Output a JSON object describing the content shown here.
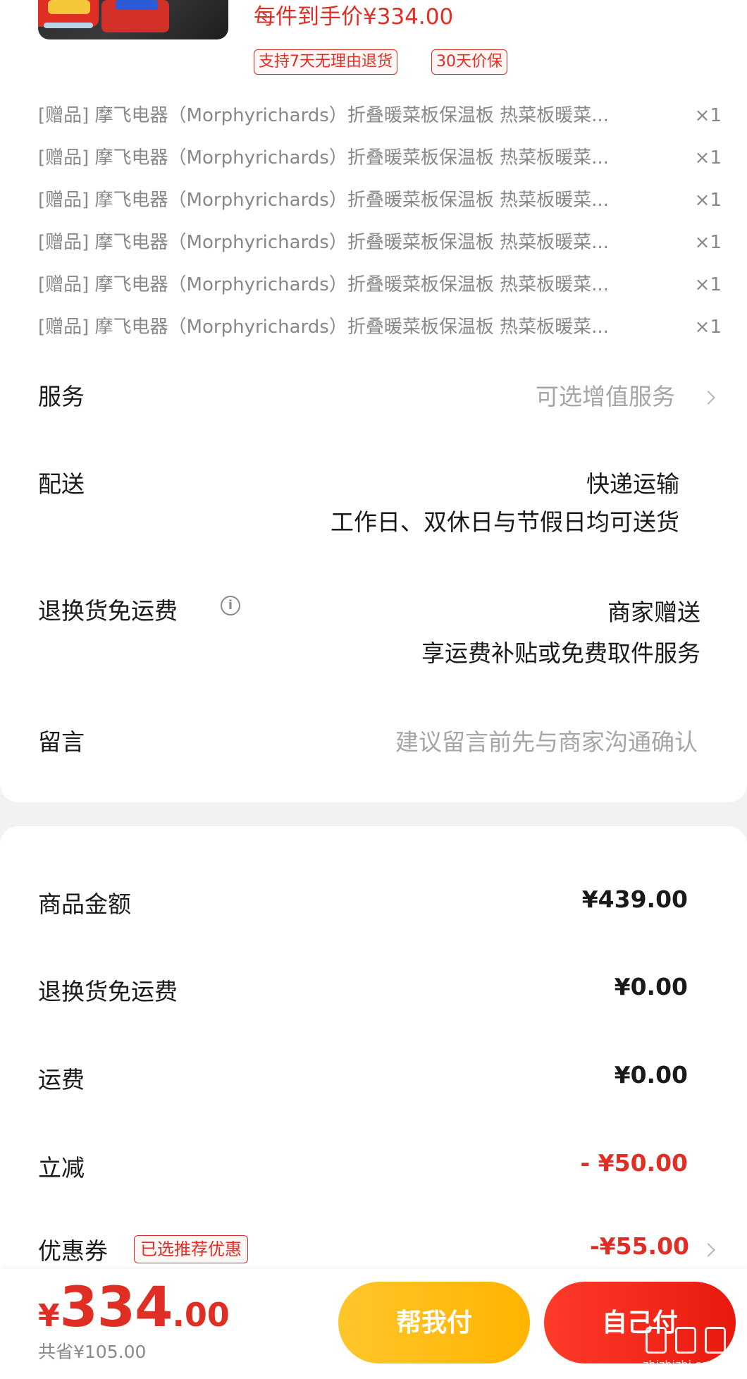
{
  "product": {
    "price_line": "每件到手价¥334.00",
    "tags": [
      "支持7天无理由退货",
      "30天价保"
    ]
  },
  "gifts": [
    {
      "text": "[赠品] 摩飞电器（Morphyrichards）折叠暖菜板保温板 热菜板暖菜...",
      "qty": "×1"
    },
    {
      "text": "[赠品] 摩飞电器（Morphyrichards）折叠暖菜板保温板 热菜板暖菜...",
      "qty": "×1"
    },
    {
      "text": "[赠品] 摩飞电器（Morphyrichards）折叠暖菜板保温板 热菜板暖菜...",
      "qty": "×1"
    },
    {
      "text": "[赠品] 摩飞电器（Morphyrichards）折叠暖菜板保温板 热菜板暖菜...",
      "qty": "×1"
    },
    {
      "text": "[赠品] 摩飞电器（Morphyrichards）折叠暖菜板保温板 热菜板暖菜...",
      "qty": "×1"
    },
    {
      "text": "[赠品] 摩飞电器（Morphyrichards）折叠暖菜板保温板 热菜板暖菜...",
      "qty": "×1"
    }
  ],
  "service": {
    "label": "服务",
    "value": "可选增值服务"
  },
  "delivery": {
    "label": "配送",
    "method": "快递运输",
    "note": "工作日、双休日与节假日均可送货"
  },
  "return_shipping": {
    "label": "退换货免运费",
    "value": "商家赠送",
    "note": "享运费补贴或免费取件服务"
  },
  "message": {
    "label": "留言",
    "placeholder": "建议留言前先与商家沟通确认"
  },
  "summary": {
    "goods_label": "商品金额",
    "goods_value": "¥439.00",
    "return_label": "退换货免运费",
    "return_value": "¥0.00",
    "freight_label": "运费",
    "freight_value": "¥0.00",
    "discount_label": "立减",
    "discount_value": "- ¥50.00",
    "coupon_label": "优惠券",
    "coupon_badge": "已选推荐优惠",
    "coupon_value": "-¥55.00"
  },
  "bottom": {
    "currency": "¥",
    "total_int": "334",
    "total_dec": ".00",
    "saved": "共省¥105.00",
    "help_pay": "帮我付",
    "self_pay": "自己付"
  },
  "watermark": {
    "text": "zhizhizhi.com"
  },
  "colors": {
    "accent": "#e02e24",
    "help_button": "#ffbd1a",
    "self_button": "#f0281a"
  },
  "icons": [
    "info-icon",
    "chevron-right-icon"
  ]
}
